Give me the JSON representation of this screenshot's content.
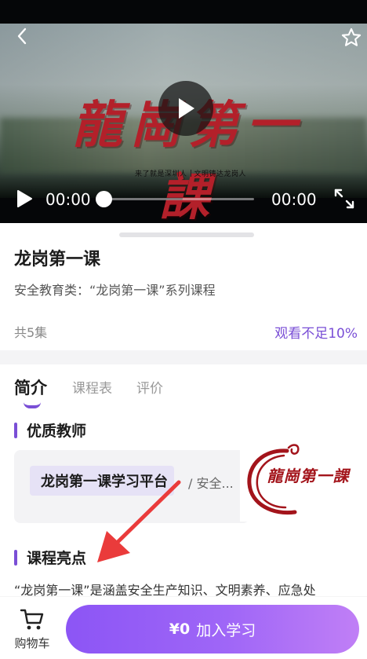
{
  "video": {
    "title_art": "龍崗第一課",
    "subtitle_left": "来了就是深圳人",
    "subtitle_right": "文明铸达龙岗人",
    "current_time": "00:00",
    "total_time": "00:00",
    "progress": 0
  },
  "course": {
    "title": "龙岗第一课",
    "description": "安全教育类：“龙岗第一课”系列课程",
    "episodes": "共5集",
    "watch_progress": "观看不足10%"
  },
  "tabs": [
    {
      "label": "简介",
      "active": true
    },
    {
      "label": "课程表",
      "active": false
    },
    {
      "label": "评价",
      "active": false
    }
  ],
  "sections": {
    "teachers_heading": "优质教师",
    "highlights_heading": "课程亮点"
  },
  "teacher": {
    "name": "龙岗第一课学习平台",
    "tag": "/ 安全..."
  },
  "logo": {
    "text": "龍崗第一課"
  },
  "highlights_text": "“龙岗第一课”是涵盖安全生产知识、文明素养、应急处",
  "bottom_bar": {
    "cart_label": "购物车",
    "price": "¥0",
    "join_label": "加入学习"
  },
  "colors": {
    "accent": "#7a4fd6",
    "button_gradient_start": "#8c55f5",
    "button_gradient_end": "#c07ff6",
    "title_red": "#b3202a"
  }
}
